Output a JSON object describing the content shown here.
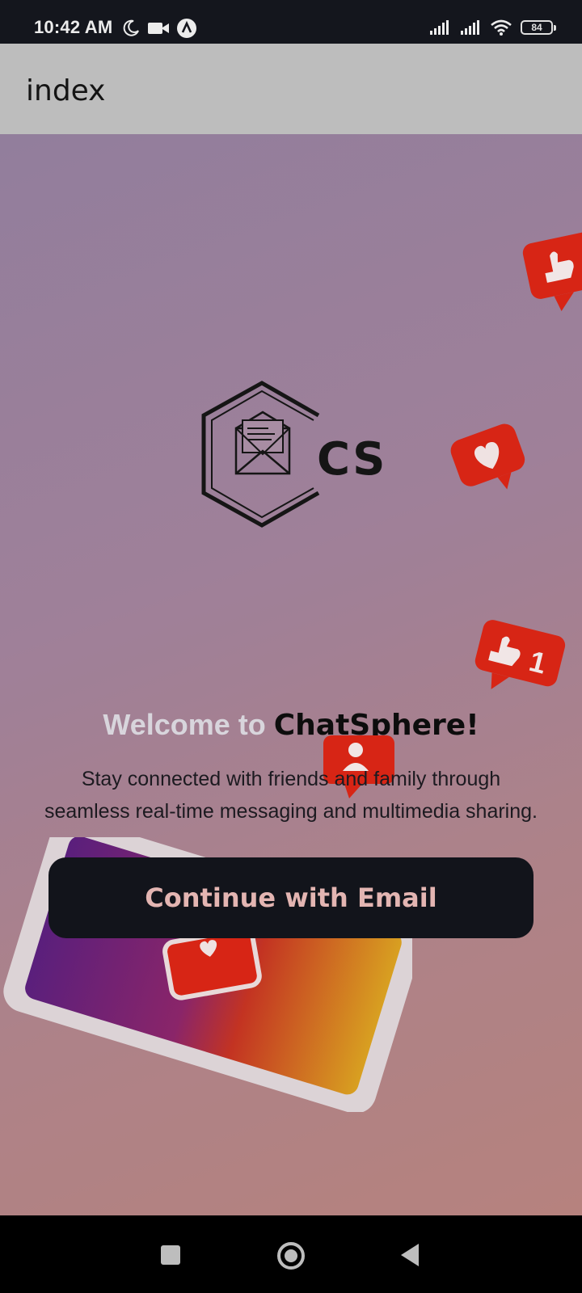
{
  "status_bar": {
    "time": "10:42 AM",
    "battery": "84",
    "left_icons": [
      "moon-icon",
      "video-icon",
      "assistant-icon"
    ],
    "right_icons": [
      "signal-icon",
      "signal-icon",
      "wifi-icon",
      "battery-icon"
    ]
  },
  "app_bar": {
    "title": "index"
  },
  "logo": {
    "letters": "CS"
  },
  "welcome": {
    "prefix": "Welcome to ",
    "brand": "ChatSphere!"
  },
  "description": "Stay connected with friends and family through seamless real-time messaging and multimedia sharing.",
  "cta": {
    "label": "Continue with Email"
  },
  "decorations": [
    "thumbs-up-bubble",
    "heart-bubble",
    "thumbs-up-1-bubble",
    "follower-bubble",
    "phone-illustration"
  ],
  "nav_bar": {
    "buttons": [
      "recents-button",
      "home-button",
      "back-button"
    ]
  },
  "colors": {
    "accent": "#e52b1c",
    "button_bg": "#12141b",
    "button_text": "#e3b5b2"
  }
}
